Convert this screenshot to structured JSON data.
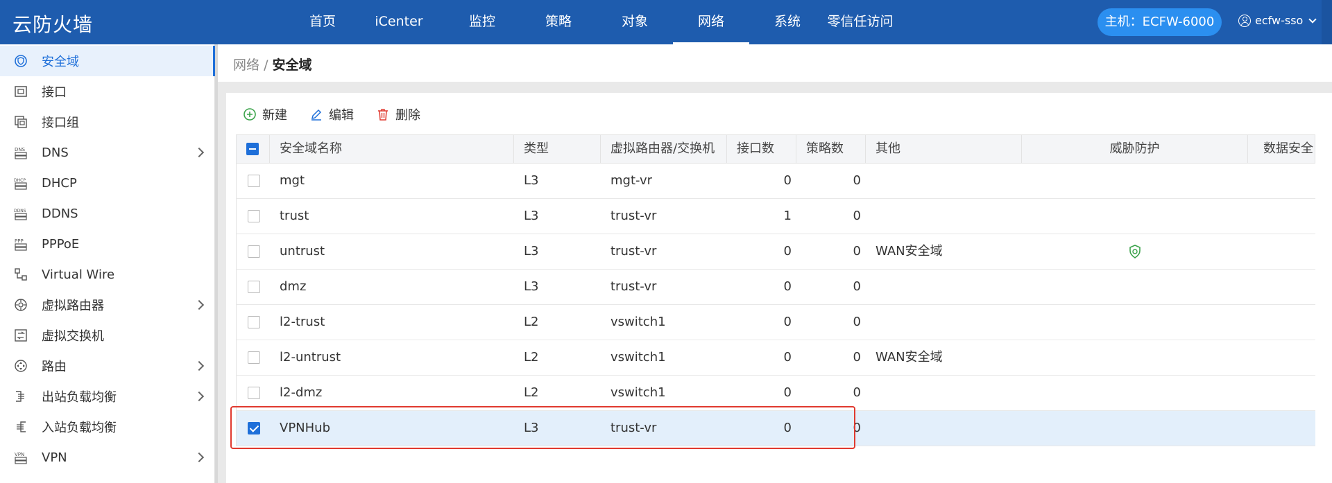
{
  "app": {
    "title": "云防火墙"
  },
  "nav": {
    "items": [
      {
        "label": "首页",
        "active": false
      },
      {
        "label": "iCenter",
        "active": false
      },
      {
        "label": "监控",
        "active": false
      },
      {
        "label": "策略",
        "active": false
      },
      {
        "label": "对象",
        "active": false
      },
      {
        "label": "网络",
        "active": true
      },
      {
        "label": "系统",
        "active": false
      },
      {
        "label": "零信任访问",
        "active": false
      }
    ]
  },
  "host": {
    "label": "主机：ECFW-6000"
  },
  "user": {
    "name": "ecfw-sso"
  },
  "sidebar": {
    "items": [
      {
        "label": "安全域",
        "icon": "shield-icon",
        "active": true,
        "expandable": false
      },
      {
        "label": "接口",
        "icon": "interface-icon",
        "active": false,
        "expandable": false
      },
      {
        "label": "接口组",
        "icon": "interface-group-icon",
        "active": false,
        "expandable": false
      },
      {
        "label": "DNS",
        "icon": "dns-icon",
        "active": false,
        "expandable": true
      },
      {
        "label": "DHCP",
        "icon": "dhcp-icon",
        "active": false,
        "expandable": false
      },
      {
        "label": "DDNS",
        "icon": "ddns-icon",
        "active": false,
        "expandable": false
      },
      {
        "label": "PPPoE",
        "icon": "pppoe-icon",
        "active": false,
        "expandable": false
      },
      {
        "label": "Virtual Wire",
        "icon": "virtual-wire-icon",
        "active": false,
        "expandable": false
      },
      {
        "label": "虚拟路由器",
        "icon": "virtual-router-icon",
        "active": false,
        "expandable": true
      },
      {
        "label": "虚拟交换机",
        "icon": "virtual-switch-icon",
        "active": false,
        "expandable": false
      },
      {
        "label": "路由",
        "icon": "route-icon",
        "active": false,
        "expandable": true
      },
      {
        "label": "出站负载均衡",
        "icon": "outbound-lb-icon",
        "active": false,
        "expandable": true
      },
      {
        "label": "入站负载均衡",
        "icon": "inbound-lb-icon",
        "active": false,
        "expandable": false
      },
      {
        "label": "VPN",
        "icon": "vpn-icon",
        "active": false,
        "expandable": true
      }
    ]
  },
  "breadcrumb": {
    "parent": "网络",
    "separator": "/",
    "current": "安全域"
  },
  "toolbar": {
    "new_label": "新建",
    "edit_label": "编辑",
    "delete_label": "删除"
  },
  "table": {
    "columns": [
      "安全域名称",
      "类型",
      "虚拟路由器/交换机",
      "接口数",
      "策略数",
      "其他",
      "威胁防护",
      "数据安全"
    ],
    "rows": [
      {
        "name": "mgt",
        "type": "L3",
        "vr": "mgt-vr",
        "interfaces": "0",
        "policies": "0",
        "other": "",
        "threat": false,
        "checked": false
      },
      {
        "name": "trust",
        "type": "L3",
        "vr": "trust-vr",
        "interfaces": "1",
        "policies": "0",
        "other": "",
        "threat": false,
        "checked": false
      },
      {
        "name": "untrust",
        "type": "L3",
        "vr": "trust-vr",
        "interfaces": "0",
        "policies": "0",
        "other": "WAN安全域",
        "threat": true,
        "checked": false
      },
      {
        "name": "dmz",
        "type": "L3",
        "vr": "trust-vr",
        "interfaces": "0",
        "policies": "0",
        "other": "",
        "threat": false,
        "checked": false
      },
      {
        "name": "l2-trust",
        "type": "L2",
        "vr": "vswitch1",
        "interfaces": "0",
        "policies": "0",
        "other": "",
        "threat": false,
        "checked": false
      },
      {
        "name": "l2-untrust",
        "type": "L2",
        "vr": "vswitch1",
        "interfaces": "0",
        "policies": "0",
        "other": "WAN安全域",
        "threat": false,
        "checked": false
      },
      {
        "name": "l2-dmz",
        "type": "L2",
        "vr": "vswitch1",
        "interfaces": "0",
        "policies": "0",
        "other": "",
        "threat": false,
        "checked": false
      },
      {
        "name": "VPNHub",
        "type": "L3",
        "vr": "trust-vr",
        "interfaces": "0",
        "policies": "0",
        "other": "",
        "threat": false,
        "checked": true
      }
    ]
  },
  "colors": {
    "brand": "#1e5cae",
    "accent": "#1e6fd9",
    "highlight": "#e0392f",
    "threat_icon": "#3aa34a"
  }
}
